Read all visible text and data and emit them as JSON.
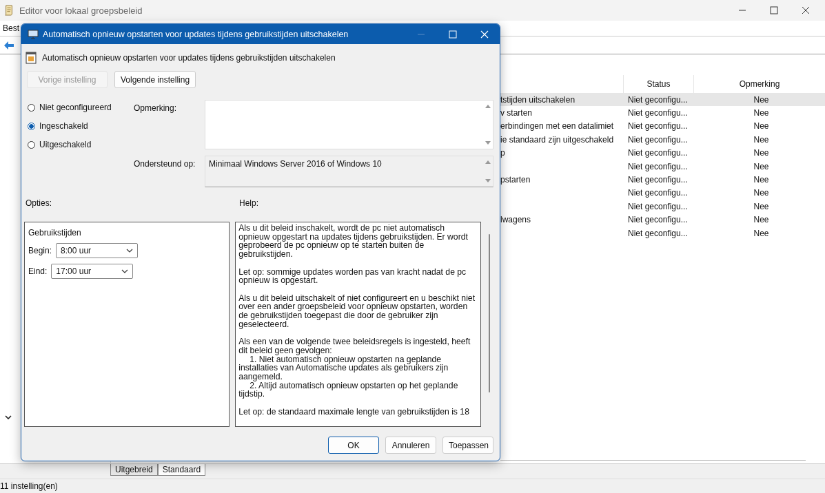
{
  "main_window": {
    "title": "Editor voor lokaal groepsbeleid",
    "menu": [
      "Best"
    ],
    "list": {
      "columns": [
        {
          "label": "Status"
        },
        {
          "label": "Opmerking"
        }
      ],
      "rows": [
        {
          "name": "tstijden uitschakelen",
          "status": "Niet geconfigu...",
          "comment": "Nee",
          "selected": true
        },
        {
          "name": "v starten",
          "status": "Niet geconfigu...",
          "comment": "Nee",
          "selected": false
        },
        {
          "name": "erbindingen met een datalimiet",
          "status": "Niet geconfigu...",
          "comment": "Nee",
          "selected": false
        },
        {
          "name": "ie standaard zijn uitgeschakeld",
          "status": "Niet geconfigu...",
          "comment": "Nee",
          "selected": false
        },
        {
          "name": "p",
          "status": "Niet geconfigu...",
          "comment": "Nee",
          "selected": false
        },
        {
          "status": "Niet geconfigu...",
          "comment": "Nee",
          "selected": false
        },
        {
          "name": "pstarten",
          "status": "Niet geconfigu...",
          "comment": "Nee",
          "selected": false
        },
        {
          "status": "Niet geconfigu...",
          "comment": "Nee",
          "selected": false
        },
        {
          "status": "Niet geconfigu...",
          "comment": "Nee",
          "selected": false
        },
        {
          "name": "lwagens",
          "status": "Niet geconfigu...",
          "comment": "Nee",
          "selected": false
        },
        {
          "status": "Niet geconfigu...",
          "comment": "Nee",
          "selected": false
        }
      ]
    },
    "tabs": [
      {
        "label": "Uitgebreid",
        "selected": false
      },
      {
        "label": "Standaard",
        "selected": true
      }
    ],
    "status_bar": "11 instelling(en)"
  },
  "dialog": {
    "title": "Automatisch opnieuw opstarten voor updates tijdens gebruikstijden uitschakelen",
    "heading": "Automatisch opnieuw opstarten voor updates tijdens gebruikstijden uitschakelen",
    "nav_buttons": [
      {
        "label": "Vorige instelling",
        "disabled": true
      },
      {
        "label": "Volgende instelling",
        "disabled": false
      }
    ],
    "radios": [
      {
        "label": "Niet geconfigureerd",
        "selected": false
      },
      {
        "label": "Ingeschakeld",
        "selected": true
      },
      {
        "label": "Uitgeschakeld",
        "selected": false
      }
    ],
    "comment_label": "Opmerking:",
    "supported_label": "Ondersteund op:",
    "supported_value": "Minimaal Windows Server 2016 of Windows 10",
    "options_label": "Opties:",
    "help_label": "Help:",
    "options": {
      "title": "Gebruikstijden",
      "fields": [
        {
          "label": "Begin:",
          "value": "8:00 uur"
        },
        {
          "label": "Eind:",
          "value": "17:00 uur"
        }
      ]
    },
    "help": [
      {
        "kind": "para",
        "text": "Als u dit beleid inschakelt, wordt de pc niet automatisch opnieuw opgestart na updates tijdens gebruikstijden. Er wordt geprobeerd de pc opnieuw op te starten buiten de gebruikstijden."
      },
      {
        "kind": "para",
        "text": "Let op: sommige updates worden pas van kracht nadat de pc opnieuw is opgestart."
      },
      {
        "kind": "para",
        "text": "Als u dit beleid uitschakelt of niet configureert en u beschikt niet over een ander groepsbeleid voor opnieuw opstarten, worden de gebruikstijden toegepast die door de gebruiker zijn geselecteerd."
      },
      {
        "kind": "para",
        "text": "Als een van de volgende twee beleidsregels is ingesteld, heeft dit beleid geen gevolgen:"
      },
      {
        "kind": "item",
        "text": "1. Niet automatisch opnieuw opstarten na geplande installaties van Automatische updates als gebruikers zijn aangemeld."
      },
      {
        "kind": "item",
        "text": "2. Altijd automatisch opnieuw opstarten op het geplande tijdstip."
      },
      {
        "kind": "para",
        "text": "Let op: de standaard maximale lengte van gebruikstijden is 18"
      }
    ],
    "buttons": [
      {
        "label": "OK",
        "default": true
      },
      {
        "label": "Annuleren",
        "default": false
      },
      {
        "label": "Toepassen",
        "default": false
      }
    ]
  }
}
